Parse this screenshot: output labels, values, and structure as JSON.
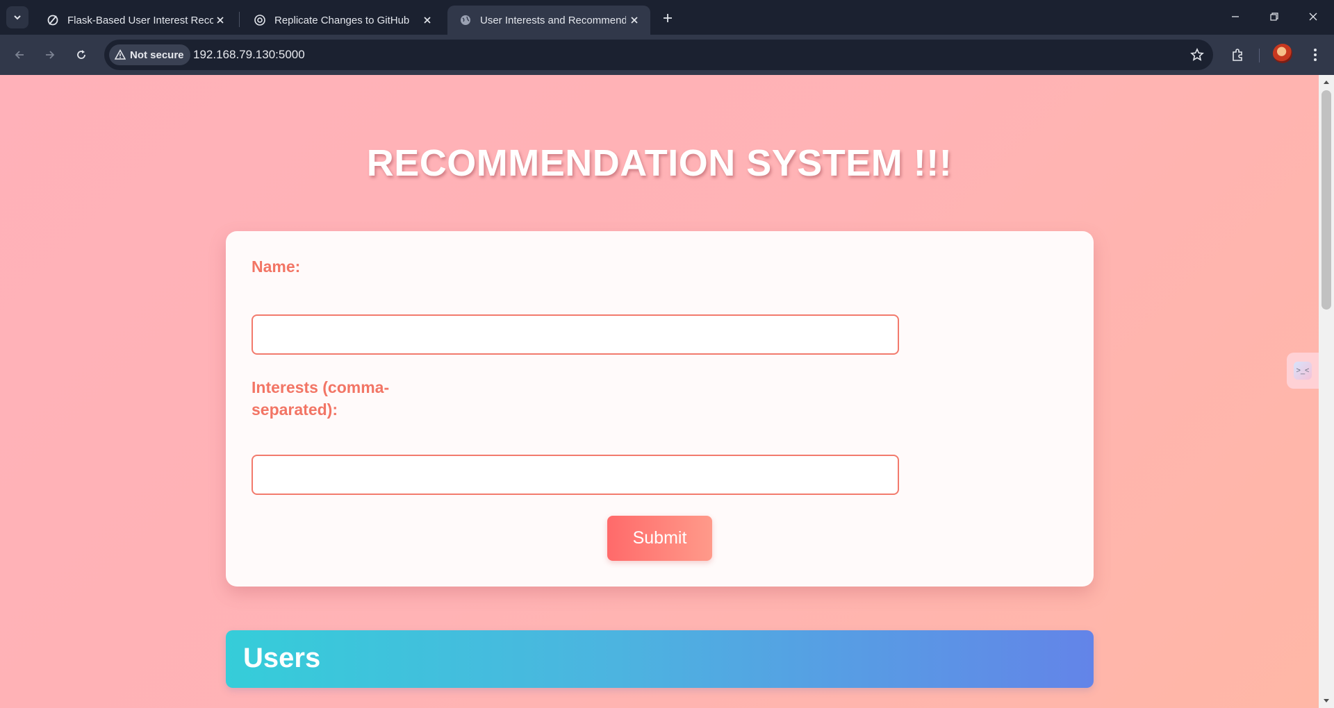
{
  "browser": {
    "tabs": [
      {
        "title": "Flask-Based User Interest Recom",
        "icon": "flask-icon",
        "active": false
      },
      {
        "title": "Replicate Changes to GitHub",
        "icon": "chatgpt-icon",
        "active": false
      },
      {
        "title": "User Interests and Recommenda",
        "icon": "globe-icon",
        "active": true
      }
    ],
    "security_label": "Not secure",
    "url": "192.168.79.130:5000"
  },
  "page": {
    "title": "RECOMMENDATION SYSTEM !!!",
    "form": {
      "name_label": "Name:",
      "name_value": "",
      "interests_label_line1": "Interests (comma-",
      "interests_label_line2": "separated):",
      "interests_value": "",
      "submit_label": "Submit"
    },
    "users_heading": "Users"
  },
  "colors": {
    "background": "#ffb3b5",
    "label": "#f27565",
    "submit": "#ff7a70",
    "users_gradient_start": "#35cdd9",
    "users_gradient_end": "#6384e8"
  }
}
